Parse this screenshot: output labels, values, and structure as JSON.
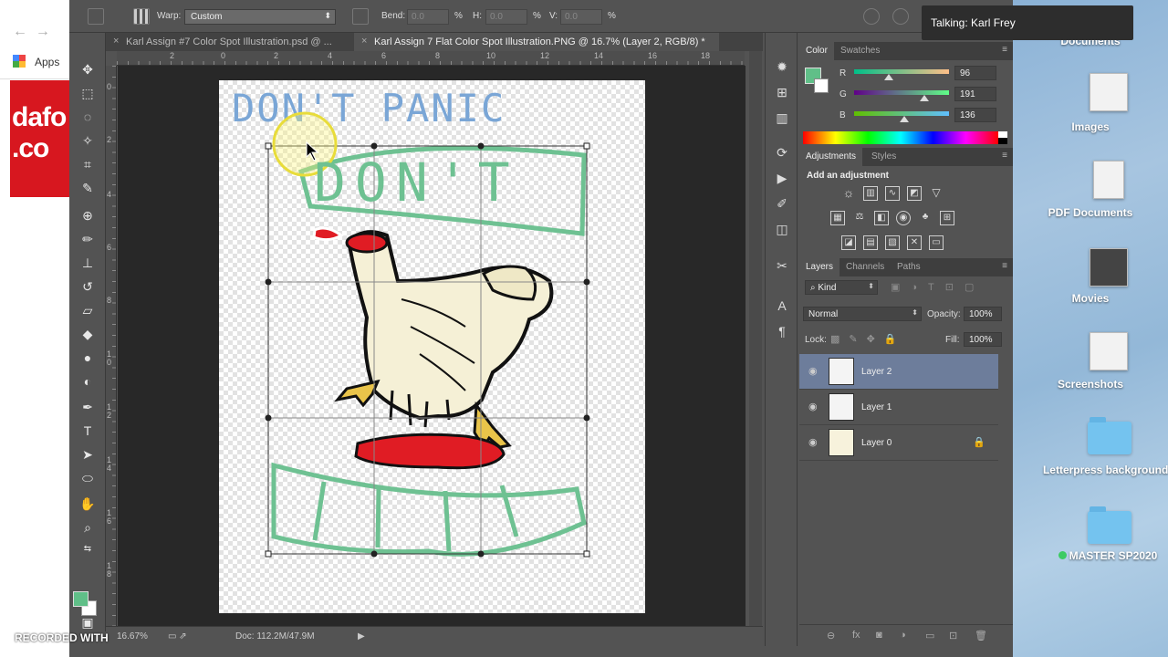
{
  "browser": {
    "apps_label": "Apps",
    "dafont_text": "dafo .co"
  },
  "options_bar": {
    "warp_label": "Warp:",
    "warp_value": "Custom",
    "bend_label": "Bend:",
    "bend_value": "0.0",
    "h_label": "H:",
    "h_value": "0.0",
    "v_label": "V:",
    "v_value": "0.0",
    "pct": "%"
  },
  "tabs": [
    {
      "label": "Karl Assign #7 Color Spot Illustration.psd @ ..."
    },
    {
      "label": "Karl Assign 7 Flat Color Spot Illustration.PNG @ 16.7% (Layer 2, RGB/8) *"
    }
  ],
  "ruler": {
    "top_numbers": [
      "2",
      "0",
      "2",
      "4",
      "6",
      "8",
      "10",
      "12",
      "14",
      "16",
      "18"
    ],
    "left_numbers": [
      "0",
      "2",
      "4",
      "6",
      "8",
      "1 0",
      "1 2",
      "1 4",
      "1 6",
      "1 8"
    ]
  },
  "artwork": {
    "title_text": "DON'T PANIC",
    "banner_text": "DON'T"
  },
  "status": {
    "zoom": "16.67%",
    "doc_info": "Doc: 112.2M/47.9M"
  },
  "color_panel": {
    "tab_color": "Color",
    "tab_swatches": "Swatches",
    "r_label": "R",
    "g_label": "G",
    "b_label": "B",
    "r_value": "96",
    "g_value": "191",
    "b_value": "136",
    "foreground_color": "#60bf88"
  },
  "adjustments_panel": {
    "tab_adjustments": "Adjustments",
    "tab_styles": "Styles",
    "heading": "Add an adjustment"
  },
  "layers_panel": {
    "tab_layers": "Layers",
    "tab_channels": "Channels",
    "tab_paths": "Paths",
    "filter_kind": "Kind",
    "blend_mode": "Normal",
    "opacity_label": "Opacity:",
    "opacity_value": "100%",
    "lock_label": "Lock:",
    "fill_label": "Fill:",
    "fill_value": "100%",
    "layers": [
      {
        "name": "Layer 2"
      },
      {
        "name": "Layer 1"
      },
      {
        "name": "Layer 0"
      }
    ]
  },
  "desktop": {
    "items": [
      {
        "label": "Documents"
      },
      {
        "label": "Images"
      },
      {
        "label": "PDF Documents"
      },
      {
        "label": "Movies"
      },
      {
        "label": "Screenshots"
      },
      {
        "label": "Letterpress backgrounds"
      },
      {
        "label": "MASTER SP2020"
      }
    ]
  },
  "overlay": {
    "talking": "Talking: Karl Frey",
    "watermark": "RECORDED WITH"
  }
}
